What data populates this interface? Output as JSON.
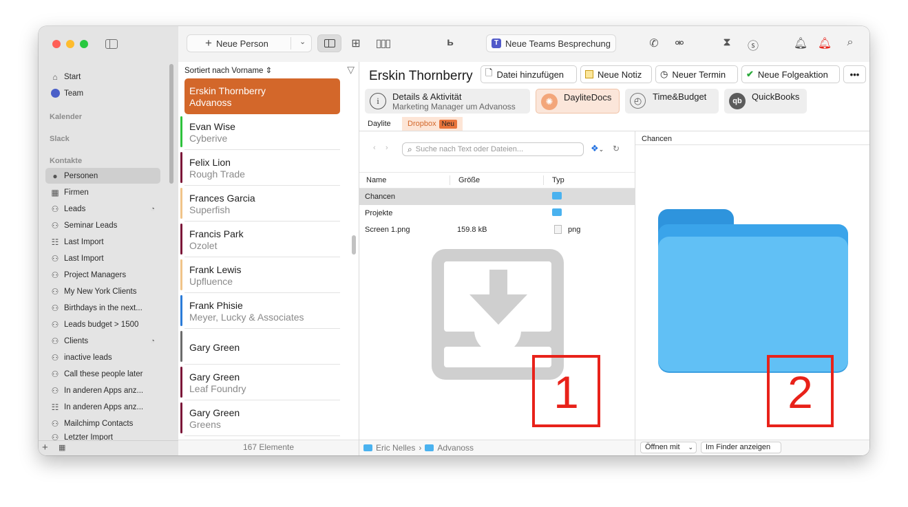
{
  "sidebar": {
    "items_top": [
      {
        "label": "Start",
        "icon": "house-icon"
      },
      {
        "label": "Team",
        "icon": "team-icon"
      }
    ],
    "sections": {
      "calendar": "Kalender",
      "slack": "Slack",
      "contacts": "Kontakte"
    },
    "contacts_items": [
      {
        "label": "Personen",
        "icon": "person-icon"
      },
      {
        "label": "Firmen",
        "icon": "building-icon"
      },
      {
        "label": "Leads",
        "icon": "person-group-icon"
      },
      {
        "label": "Seminar Leads",
        "icon": "person-group-icon"
      },
      {
        "label": "Last Import",
        "icon": "list-icon"
      },
      {
        "label": "Last Import",
        "icon": "person-group-icon"
      },
      {
        "label": "Project Managers",
        "icon": "person-group-icon"
      },
      {
        "label": "My New York Clients",
        "icon": "person-group-icon"
      },
      {
        "label": "Birthdays in the next...",
        "icon": "person-group-icon"
      },
      {
        "label": "Leads budget > 1500",
        "icon": "person-group-icon"
      },
      {
        "label": "Clients",
        "icon": "person-group-icon"
      },
      {
        "label": "inactive leads",
        "icon": "person-group-icon"
      },
      {
        "label": "Call these people later",
        "icon": "person-group-icon"
      },
      {
        "label": "In anderen Apps anz...",
        "icon": "person-group-icon"
      },
      {
        "label": "In anderen Apps anz...",
        "icon": "list-icon"
      },
      {
        "label": "Mailchimp Contacts",
        "icon": "person-group-icon"
      },
      {
        "label": "Letzter Import",
        "icon": "person-group-icon"
      }
    ]
  },
  "toolbar": {
    "new_person_label": "Neue Person",
    "teams_label": "Neue Teams Besprechung"
  },
  "list": {
    "sort_label": "Sortiert nach Vorname",
    "footer": "167 Elemente",
    "contacts": [
      {
        "name": "Erskin Thornberry",
        "company": "Advanoss",
        "color": "#d3672a"
      },
      {
        "name": "Evan Wise",
        "company": "Cyberive",
        "color": "#2ec23c"
      },
      {
        "name": "Felix Lion",
        "company": "Rough Trade",
        "color": "#7b1538"
      },
      {
        "name": "Frances Garcia",
        "company": "Superfish",
        "color": "#f0c489"
      },
      {
        "name": "Francis Park",
        "company": "Ozolet",
        "color": "#7b1538"
      },
      {
        "name": "Frank Lewis",
        "company": "Upfluence",
        "color": "#f0c489"
      },
      {
        "name": "Frank Phisie",
        "company": "Meyer, Lucky & Associates",
        "color": "#2b7bd8"
      },
      {
        "name": "Gary Green",
        "company": "",
        "color": "#6b6b6b"
      },
      {
        "name": "Gary Green",
        "company": "Leaf Foundry",
        "color": "#7b1538"
      },
      {
        "name": "Gary Green",
        "company": "Greens",
        "color": "#7b1538"
      }
    ]
  },
  "detail": {
    "name": "Erskin Thornberry",
    "actions": {
      "add_file": "Datei hinzufügen",
      "new_note": "Neue Notiz",
      "new_appointment": "Neuer Termin",
      "new_followup": "Neue Folgeaktion"
    },
    "tabs": {
      "details_title": "Details & Aktivität",
      "details_sub": "Marketing Manager um Advanoss",
      "daylitedocs": "DayliteDocs",
      "timebudget": "Time&Budget",
      "quickbooks": "QuickBooks"
    },
    "subtabs": {
      "daylite": "Daylite",
      "dropbox": "Dropbox",
      "badge": "Neu"
    },
    "browser": {
      "search_placeholder": "Suche nach Text oder Dateien...",
      "col_name": "Name",
      "col_size": "Größe",
      "col_type": "Typ",
      "files": [
        {
          "name": "Chancen",
          "size": "",
          "type": ""
        },
        {
          "name": "Projekte",
          "size": "",
          "type": ""
        },
        {
          "name": "Screen 1.png",
          "size": "159.8 kB",
          "type": "png"
        }
      ]
    },
    "preview_title": "Chancen",
    "annotations": {
      "one": "1",
      "two": "2"
    },
    "breadcrumb": {
      "a": "Eric Nelles",
      "sep": "›",
      "b": "Advanoss"
    },
    "open_with": "Öffnen mit",
    "show_finder": "Im Finder anzeigen"
  },
  "colors": {
    "accent": "#d3672a",
    "selection_bg": "#cfcfcf",
    "annotation": "#e8221a",
    "folder": "#4ab2ef"
  }
}
